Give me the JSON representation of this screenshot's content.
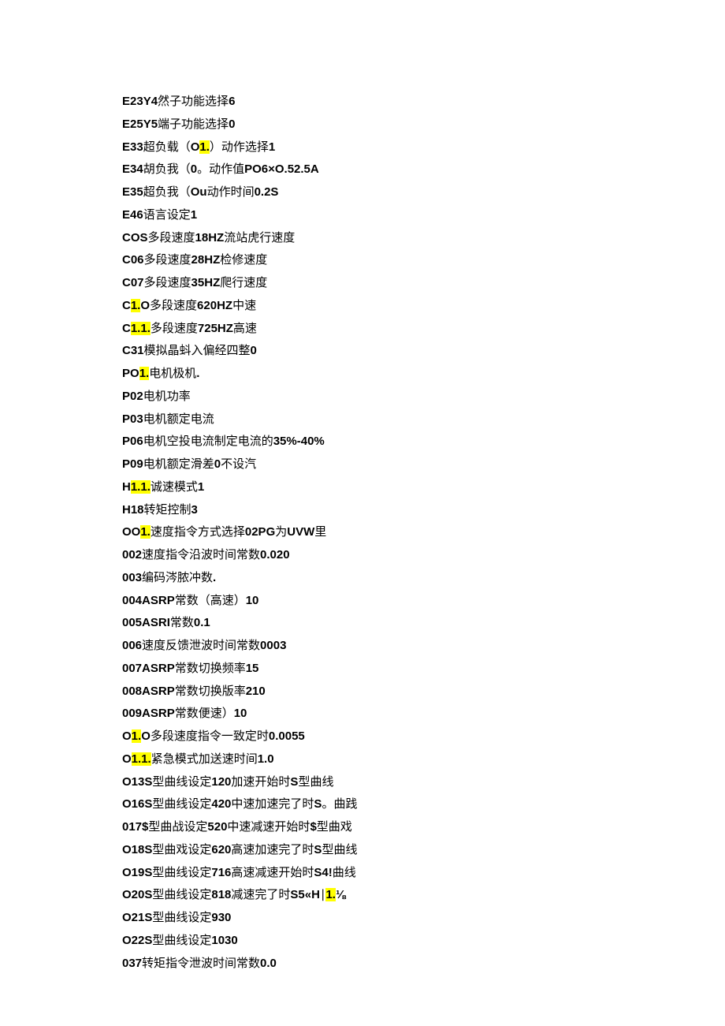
{
  "lines": [
    {
      "segments": [
        {
          "t": "E23Y4",
          "b": true
        },
        {
          "t": "然子功能选择"
        },
        {
          "t": "6",
          "b": true
        }
      ]
    },
    {
      "segments": [
        {
          "t": "E25Y5",
          "b": true
        },
        {
          "t": "端子功能选择"
        },
        {
          "t": "0",
          "b": true
        }
      ]
    },
    {
      "segments": [
        {
          "t": "E33",
          "b": true
        },
        {
          "t": "超负载（"
        },
        {
          "t": "O",
          "b": true
        },
        {
          "t": "1.",
          "b": true,
          "hl": true
        },
        {
          "t": "）动作选择"
        },
        {
          "t": "1",
          "b": true
        }
      ]
    },
    {
      "segments": [
        {
          "t": "E34",
          "b": true
        },
        {
          "t": "胡负我（"
        },
        {
          "t": "0",
          "b": true
        },
        {
          "t": "。动作值"
        },
        {
          "t": "PO6×O.52.5A",
          "b": true
        }
      ]
    },
    {
      "segments": [
        {
          "t": "E35",
          "b": true
        },
        {
          "t": "超负我（"
        },
        {
          "t": "Ou",
          "b": true
        },
        {
          "t": "动作时间"
        },
        {
          "t": "0.2S",
          "b": true
        }
      ]
    },
    {
      "segments": [
        {
          "t": "E46",
          "b": true
        },
        {
          "t": "语言设定"
        },
        {
          "t": "1",
          "b": true
        }
      ]
    },
    {
      "segments": [
        {
          "t": "COS",
          "b": true
        },
        {
          "t": "多段速度"
        },
        {
          "t": "18HZ",
          "b": true
        },
        {
          "t": "流站虎行速度"
        }
      ]
    },
    {
      "segments": [
        {
          "t": "C06",
          "b": true
        },
        {
          "t": "多段速度"
        },
        {
          "t": "28HZ",
          "b": true
        },
        {
          "t": "检修速度"
        }
      ]
    },
    {
      "segments": [
        {
          "t": "C07",
          "b": true
        },
        {
          "t": "多段速度"
        },
        {
          "t": "35HZ",
          "b": true
        },
        {
          "t": "爬行速度"
        }
      ]
    },
    {
      "segments": [
        {
          "t": "C",
          "b": true
        },
        {
          "t": "1.",
          "b": true,
          "hl": true
        },
        {
          "t": "O",
          "b": true
        },
        {
          "t": "多段速度"
        },
        {
          "t": "620HZ",
          "b": true
        },
        {
          "t": "中速"
        }
      ]
    },
    {
      "segments": [
        {
          "t": "C",
          "b": true
        },
        {
          "t": "1.1.",
          "b": true,
          "hl": true
        },
        {
          "t": "多段速度"
        },
        {
          "t": "725HZ",
          "b": true
        },
        {
          "t": "高速"
        }
      ]
    },
    {
      "segments": [
        {
          "t": "C31",
          "b": true
        },
        {
          "t": "模拟晶蚪入偏经四整"
        },
        {
          "t": "0",
          "b": true
        }
      ]
    },
    {
      "segments": [
        {
          "t": "PO",
          "b": true
        },
        {
          "t": "1.",
          "b": true,
          "hl": true
        },
        {
          "t": "电机极机"
        },
        {
          "t": ".",
          "b": true
        }
      ]
    },
    {
      "segments": [
        {
          "t": "P02",
          "b": true
        },
        {
          "t": "电机功率"
        }
      ]
    },
    {
      "segments": [
        {
          "t": "P03",
          "b": true
        },
        {
          "t": "电机额定电流"
        }
      ]
    },
    {
      "segments": [
        {
          "t": "P06",
          "b": true
        },
        {
          "t": "电机空投电流制定电流的"
        },
        {
          "t": "35%-40%",
          "b": true
        }
      ]
    },
    {
      "segments": [
        {
          "t": "P09",
          "b": true
        },
        {
          "t": "电机额定滑差"
        },
        {
          "t": "0",
          "b": true
        },
        {
          "t": "不设汽"
        }
      ]
    },
    {
      "segments": [
        {
          "t": "H",
          "b": true
        },
        {
          "t": "1.1.",
          "b": true,
          "hl": true
        },
        {
          "t": "诚速模式"
        },
        {
          "t": "1",
          "b": true
        }
      ]
    },
    {
      "segments": [
        {
          "t": "H18",
          "b": true
        },
        {
          "t": "转矩控制"
        },
        {
          "t": "3",
          "b": true
        }
      ]
    },
    {
      "segments": [
        {
          "t": "OO",
          "b": true
        },
        {
          "t": "1.",
          "b": true,
          "hl": true
        },
        {
          "t": "速度指令方式选择"
        },
        {
          "t": "02PG",
          "b": true
        },
        {
          "t": "为"
        },
        {
          "t": "UVW",
          "b": true
        },
        {
          "t": "里"
        }
      ]
    },
    {
      "segments": [
        {
          "t": "002",
          "b": true
        },
        {
          "t": "速度指令沿波时间常数"
        },
        {
          "t": "0.020",
          "b": true
        }
      ]
    },
    {
      "segments": [
        {
          "t": "003",
          "b": true
        },
        {
          "t": "编码涔脓冲数"
        },
        {
          "t": ".",
          "b": true
        }
      ]
    },
    {
      "segments": [
        {
          "t": "004ASRP",
          "b": true
        },
        {
          "t": "常数（高速）"
        },
        {
          "t": "10",
          "b": true
        }
      ]
    },
    {
      "segments": [
        {
          "t": "005ASRI",
          "b": true
        },
        {
          "t": "常数"
        },
        {
          "t": "0.1",
          "b": true
        }
      ]
    },
    {
      "segments": [
        {
          "t": "006",
          "b": true
        },
        {
          "t": "速度反馈泄波时间常数"
        },
        {
          "t": "0003",
          "b": true
        }
      ]
    },
    {
      "segments": [
        {
          "t": "007ASRP",
          "b": true
        },
        {
          "t": "常数切换频率"
        },
        {
          "t": "15",
          "b": true
        }
      ]
    },
    {
      "segments": [
        {
          "t": "008ASRP",
          "b": true
        },
        {
          "t": "常数切换版率"
        },
        {
          "t": "210",
          "b": true
        }
      ]
    },
    {
      "segments": [
        {
          "t": "009ASRP",
          "b": true
        },
        {
          "t": "常数便速）"
        },
        {
          "t": "10",
          "b": true
        }
      ]
    },
    {
      "segments": [
        {
          "t": "O",
          "b": true
        },
        {
          "t": "1.",
          "b": true,
          "hl": true
        },
        {
          "t": "O",
          "b": true
        },
        {
          "t": "多段速度指令一致定时"
        },
        {
          "t": "0.0055",
          "b": true
        }
      ]
    },
    {
      "segments": [
        {
          "t": "O",
          "b": true
        },
        {
          "t": "1.1.",
          "b": true,
          "hl": true
        },
        {
          "t": "紧急模式加送速时间"
        },
        {
          "t": "1.0",
          "b": true
        }
      ]
    },
    {
      "segments": [
        {
          "t": "O13S",
          "b": true
        },
        {
          "t": "型曲线设定"
        },
        {
          "t": "120",
          "b": true
        },
        {
          "t": "加速开始时"
        },
        {
          "t": "S",
          "b": true
        },
        {
          "t": "型曲线"
        }
      ]
    },
    {
      "segments": [
        {
          "t": "O16S",
          "b": true
        },
        {
          "t": "型曲线设定"
        },
        {
          "t": "420",
          "b": true
        },
        {
          "t": "中速加速完了时"
        },
        {
          "t": "S",
          "b": true
        },
        {
          "t": "。曲践"
        }
      ]
    },
    {
      "segments": [
        {
          "t": "017$",
          "b": true
        },
        {
          "t": "型曲战设定"
        },
        {
          "t": "520",
          "b": true
        },
        {
          "t": "中速减速开始时"
        },
        {
          "t": "$",
          "b": true
        },
        {
          "t": "型曲戏"
        }
      ]
    },
    {
      "segments": [
        {
          "t": "O18S",
          "b": true
        },
        {
          "t": "型曲戏设定"
        },
        {
          "t": "620",
          "b": true
        },
        {
          "t": "高速加速完了时"
        },
        {
          "t": "S",
          "b": true
        },
        {
          "t": "型曲线"
        }
      ]
    },
    {
      "segments": [
        {
          "t": "O19S",
          "b": true
        },
        {
          "t": "型曲线设定"
        },
        {
          "t": "716",
          "b": true
        },
        {
          "t": "高速减速开始时"
        },
        {
          "t": "S4!",
          "b": true
        },
        {
          "t": "曲线"
        }
      ]
    },
    {
      "segments": [
        {
          "t": "O20S",
          "b": true
        },
        {
          "t": "型曲线设定"
        },
        {
          "t": "818",
          "b": true
        },
        {
          "t": "减速完了时"
        },
        {
          "t": "S5«H",
          "b": true
        },
        {
          "t": "∣"
        },
        {
          "t": "1.",
          "b": true,
          "hl": true
        },
        {
          "t": "⅛",
          "b": true
        }
      ]
    },
    {
      "segments": [
        {
          "t": "O21S",
          "b": true
        },
        {
          "t": "型曲线设定"
        },
        {
          "t": "930",
          "b": true
        }
      ]
    },
    {
      "segments": [
        {
          "t": "O22S",
          "b": true
        },
        {
          "t": "型曲线设定"
        },
        {
          "t": "1030",
          "b": true
        }
      ]
    },
    {
      "segments": [
        {
          "t": "037",
          "b": true
        },
        {
          "t": "转矩指令泄波时间常数"
        },
        {
          "t": "0.0",
          "b": true
        }
      ]
    }
  ]
}
